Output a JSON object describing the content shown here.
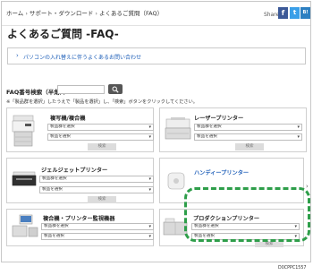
{
  "breadcrumb": [
    "ホーム",
    "サポート・ダウンロード",
    "よくあるご質問（FAQ）"
  ],
  "share": {
    "label": "Share",
    "facebook": "f",
    "twitter": "t",
    "hatena": "B!"
  },
  "page_title": "よくあるご質問 -FAQ-",
  "notice": {
    "text": "パソコンの入れ替えに伴うよくあるお問い合わせ"
  },
  "faq_search": {
    "label": "FAQ番号検索（半角）：",
    "value": "",
    "button_icon": "search-icon"
  },
  "instruction": "※「製品群を選択」したうえで「製品を選択」し、「検索」ボタンをクリックしてください。",
  "categories": [
    {
      "title": "複写機/複合機",
      "select1": "製品群を選択",
      "select2": "製品を選択",
      "button": "検索"
    },
    {
      "title": "レーザープリンター",
      "select1": "製品群を選択",
      "select2": "製品を選択",
      "button": "検索"
    },
    {
      "title": "ジェルジェットプリンター",
      "select1": "製品群を選択",
      "select2": "製品を選択",
      "button": "検索"
    },
    {
      "title": "ハンディープリンター"
    },
    {
      "title": "複合機・プリンター監視機器",
      "select1": "製品群を選択",
      "select2": "製品を選択",
      "button": "検索"
    },
    {
      "title": "プロダクションプリンター",
      "select1": "製品群を選択",
      "select2": "製品を選択",
      "button": "検索"
    }
  ],
  "colors": {
    "link": "#1d5eb8",
    "highlight": "#2e9e4a",
    "facebook": "#3b5998",
    "twitter": "#3a9fe8"
  },
  "figure_code": "D0CPPC1557"
}
